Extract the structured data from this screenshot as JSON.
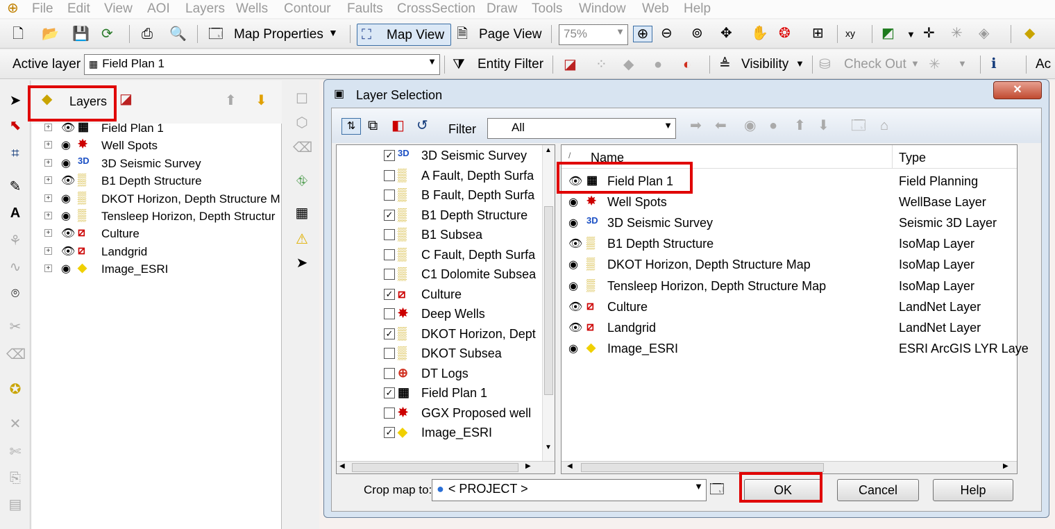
{
  "menu": [
    "File",
    "Edit",
    "View",
    "AOI",
    "Layers",
    "Wells",
    "Contour",
    "Faults",
    "CrossSection",
    "Draw",
    "Tools",
    "Window",
    "Web",
    "Help"
  ],
  "toolbar1": {
    "map_properties": "Map Properties",
    "map_view": "Map View",
    "page_view": "Page View",
    "zoom": "75%"
  },
  "toolbar2": {
    "active_layer_label": "Active layer",
    "active_layer_value": "Field Plan 1",
    "entity_filter": "Entity Filter",
    "visibility": "Visibility",
    "check_out": "Check Out",
    "more": "Ac"
  },
  "layers_panel": {
    "title": "Layers",
    "items": [
      {
        "label": "Field Plan 1",
        "eye": "open"
      },
      {
        "label": "Well Spots",
        "eye": "closed"
      },
      {
        "label": "3D Seismic Survey",
        "eye": "closed"
      },
      {
        "label": "B1 Depth Structure",
        "eye": "open"
      },
      {
        "label": "DKOT Horizon, Depth Structure M",
        "eye": "closed"
      },
      {
        "label": "Tensleep Horizon, Depth Structur",
        "eye": "closed"
      },
      {
        "label": "Culture",
        "eye": "open"
      },
      {
        "label": "Landgrid",
        "eye": "open"
      },
      {
        "label": "Image_ESRI",
        "eye": "closed"
      }
    ]
  },
  "dialog": {
    "title": "Layer Selection",
    "filter_label": "Filter",
    "filter_value": "All",
    "left_list": [
      {
        "label": "3D Seismic Survey",
        "checked": true
      },
      {
        "label": "A Fault, Depth Surfa",
        "checked": false
      },
      {
        "label": "B Fault, Depth Surfa",
        "checked": false
      },
      {
        "label": "B1 Depth Structure",
        "checked": true
      },
      {
        "label": "B1 Subsea",
        "checked": false
      },
      {
        "label": "C Fault, Depth Surfa",
        "checked": false
      },
      {
        "label": "C1 Dolomite Subsea",
        "checked": false
      },
      {
        "label": "Culture",
        "checked": true
      },
      {
        "label": "Deep Wells",
        "checked": false
      },
      {
        "label": "DKOT Horizon, Dept",
        "checked": true
      },
      {
        "label": "DKOT Subsea",
        "checked": false
      },
      {
        "label": "DT Logs",
        "checked": false
      },
      {
        "label": "Field Plan 1",
        "checked": true
      },
      {
        "label": "GGX Proposed well",
        "checked": false
      },
      {
        "label": "Image_ESRI",
        "checked": true
      }
    ],
    "columns": {
      "name": "Name",
      "type": "Type"
    },
    "rows": [
      {
        "name": "Field Plan 1",
        "type": "Field Planning"
      },
      {
        "name": "Well Spots",
        "type": "WellBase Layer"
      },
      {
        "name": "3D Seismic Survey",
        "type": "Seismic 3D Layer"
      },
      {
        "name": "B1 Depth Structure",
        "type": "IsoMap Layer"
      },
      {
        "name": "DKOT Horizon, Depth Structure Map",
        "type": "IsoMap Layer"
      },
      {
        "name": "Tensleep Horizon, Depth Structure Map",
        "type": "IsoMap Layer"
      },
      {
        "name": "Culture",
        "type": "LandNet Layer"
      },
      {
        "name": "Landgrid",
        "type": "LandNet Layer"
      },
      {
        "name": "Image_ESRI",
        "type": "ESRI ArcGIS LYR Laye"
      }
    ],
    "crop_label": "Crop map to:",
    "crop_value": "< PROJECT >",
    "ok": "OK",
    "cancel": "Cancel",
    "help": "Help"
  }
}
